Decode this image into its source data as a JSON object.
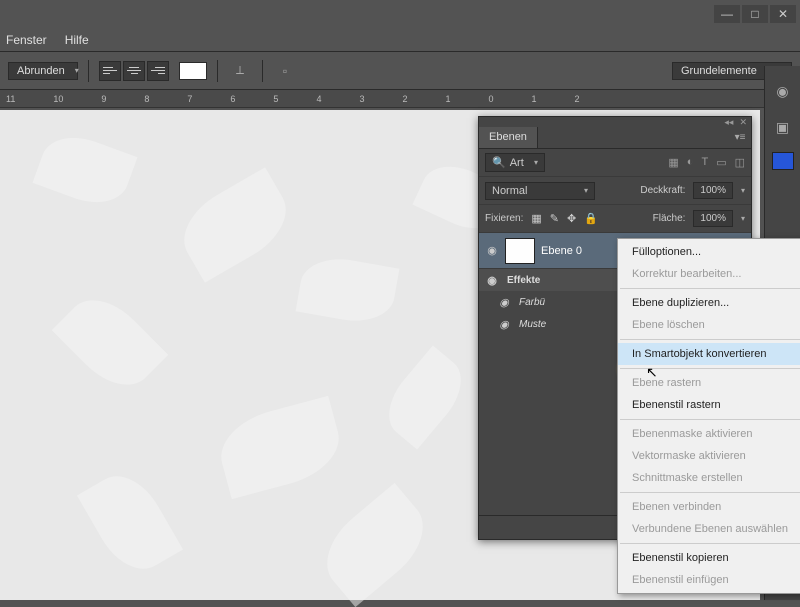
{
  "menu": {
    "fenster": "Fenster",
    "hilfe": "Hilfe"
  },
  "options": {
    "shape_mode": "Abrunden",
    "grundelemente": "Grundelemente"
  },
  "ruler": [
    "11",
    "10",
    "9",
    "8",
    "7",
    "6",
    "5",
    "4",
    "3",
    "2",
    "1",
    "0",
    "1",
    "2"
  ],
  "panel": {
    "tab": "Ebenen",
    "filter_label": "Art",
    "blend_mode": "Normal",
    "opacity_label": "Deckkraft:",
    "opacity_value": "100%",
    "lock_label": "Fixieren:",
    "fill_label": "Fläche:",
    "fill_value": "100%",
    "layer_name": "Ebene 0",
    "fx_header": "Effekte",
    "fx1": "Farbü",
    "fx2": "Muste"
  },
  "ctx": {
    "fulloptionen": "Fülloptionen...",
    "korrektur": "Korrektur bearbeiten...",
    "duplizieren": "Ebene duplizieren...",
    "loeschen": "Ebene löschen",
    "smart": "In Smartobjekt konvertieren",
    "rastern": "Ebene rastern",
    "stilrastern": "Ebenenstil rastern",
    "maske": "Ebenenmaske aktivieren",
    "vektor": "Vektormaske aktivieren",
    "schnitt": "Schnittmaske erstellen",
    "verbinden": "Ebenen verbinden",
    "verbundene": "Verbundene Ebenen auswählen",
    "stilkopieren": "Ebenenstil kopieren",
    "stileinfuegen": "Ebenenstil einfügen"
  }
}
